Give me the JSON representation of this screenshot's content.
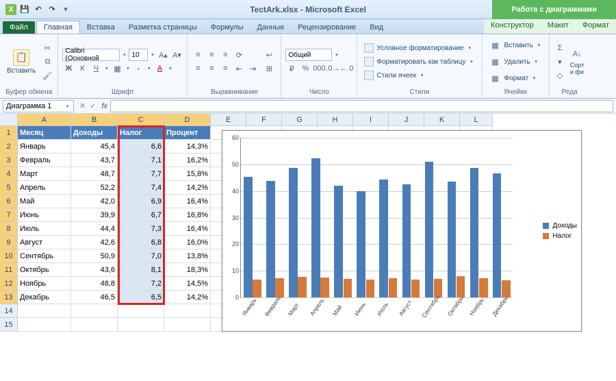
{
  "title": "TectArk.xlsx - Microsoft Excel",
  "chart_tools_title": "Работа с диаграммами",
  "tabs": {
    "file": "Файл",
    "home": "Главная",
    "insert": "Вставка",
    "layout": "Разметка страницы",
    "formulas": "Формулы",
    "data": "Данные",
    "review": "Рецензирование",
    "view": "Вид",
    "design": "Конструктор",
    "chart_layout": "Макет",
    "format": "Формат"
  },
  "ribbon": {
    "paste": "Вставить",
    "clipboard": "Буфер обмена",
    "font_name": "Calibri (Основной",
    "font_size": "10",
    "font": "Шрифт",
    "alignment": "Выравнивание",
    "number_format": "Общий",
    "number": "Число",
    "cond_format": "Условное форматирование",
    "format_table": "Форматировать как таблицу",
    "cell_styles": "Стили ячеек",
    "styles": "Стили",
    "insert_cell": "Вставить",
    "delete_cell": "Удалить",
    "format_cell": "Формат",
    "cells": "Ячейки",
    "sort": "Сорт\nи фи",
    "editing": "Реда"
  },
  "name_box": "Диаграмма 1",
  "fx": "fx",
  "columns": [
    "A",
    "B",
    "C",
    "D",
    "E",
    "F",
    "G",
    "H",
    "I",
    "J",
    "K",
    "L"
  ],
  "headers": {
    "A": "Месяц",
    "B": "Доходы",
    "C": "Налог",
    "D": "Процент"
  },
  "rows": [
    {
      "A": "Январь",
      "B": "45,4",
      "C": "6,6",
      "D": "14,3%"
    },
    {
      "A": "Февраль",
      "B": "43,7",
      "C": "7,1",
      "D": "16,2%"
    },
    {
      "A": "Март",
      "B": "48,7",
      "C": "7,7",
      "D": "15,8%"
    },
    {
      "A": "Апрель",
      "B": "52,2",
      "C": "7,4",
      "D": "14,2%"
    },
    {
      "A": "Май",
      "B": "42,0",
      "C": "6,9",
      "D": "16,4%"
    },
    {
      "A": "Июнь",
      "B": "39,9",
      "C": "6,7",
      "D": "16,8%"
    },
    {
      "A": "Июль",
      "B": "44,4",
      "C": "7,3",
      "D": "16,4%"
    },
    {
      "A": "Август",
      "B": "42,6",
      "C": "6,8",
      "D": "16,0%"
    },
    {
      "A": "Сентябрь",
      "B": "50,9",
      "C": "7,0",
      "D": "13,8%"
    },
    {
      "A": "Октябрь",
      "B": "43,6",
      "C": "8,1",
      "D": "18,3%"
    },
    {
      "A": "Ноябрь",
      "B": "48,8",
      "C": "7,2",
      "D": "14,5%"
    },
    {
      "A": "Декабрь",
      "B": "46,5",
      "C": "6,5",
      "D": "14,2%"
    }
  ],
  "chart_data": {
    "type": "bar",
    "categories": [
      "Январь",
      "Февраль",
      "Март",
      "Апрель",
      "Май",
      "Июнь",
      "Июль",
      "Август",
      "Сентябрь",
      "Октябрь",
      "Ноябрь",
      "Декабрь"
    ],
    "series": [
      {
        "name": "Доходы",
        "values": [
          45.4,
          43.7,
          48.7,
          52.2,
          42.0,
          39.9,
          44.4,
          42.6,
          50.9,
          43.6,
          48.8,
          46.5
        ],
        "color": "#4a7db8"
      },
      {
        "name": "Налог",
        "values": [
          6.6,
          7.1,
          7.7,
          7.4,
          6.9,
          6.7,
          7.3,
          6.8,
          7.0,
          8.1,
          7.2,
          6.5
        ],
        "color": "#d67a3a"
      }
    ],
    "ylim": [
      0,
      60
    ],
    "yticks": [
      0,
      10,
      20,
      30,
      40,
      50,
      60
    ],
    "xlabel": "",
    "ylabel": "",
    "title": "",
    "legend_position": "right"
  },
  "legend": {
    "s1": "Доходы",
    "s2": "Налог"
  }
}
